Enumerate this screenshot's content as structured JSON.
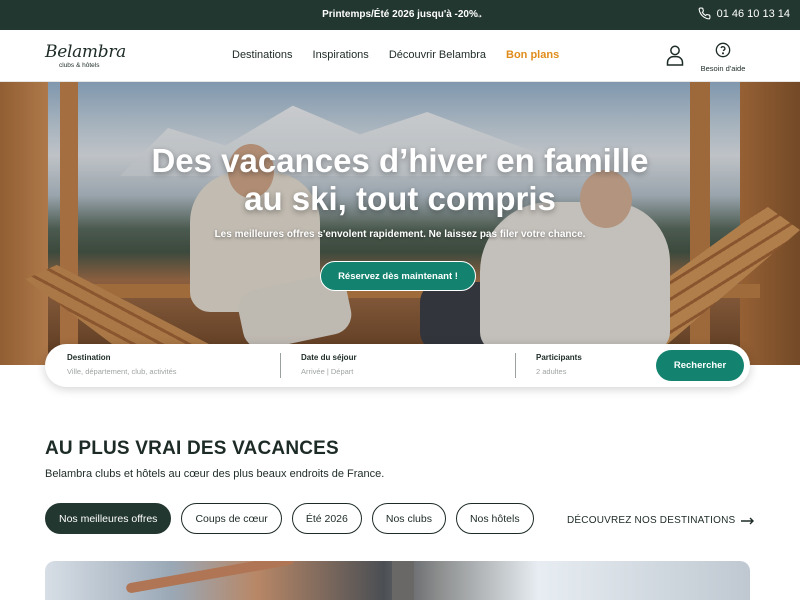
{
  "promo": {
    "text": "Printemps/Été 2026 jusqu'à -20%",
    "arrow_icon": "arrow-right-icon",
    "phone": "01 46 10 13 14",
    "phone_icon": "phone-icon"
  },
  "header": {
    "logo_main": "Belambra",
    "logo_sub": "clubs & hôtels",
    "nav": [
      "Destinations",
      "Inspirations",
      "Découvrir Belambra",
      "Bon plans"
    ],
    "account_icon": "user-icon",
    "help_label": "Besoin d'aide",
    "help_icon": "question-circle-icon"
  },
  "hero": {
    "title_line1": "Des vacances d’hiver en famille",
    "title_line2": "au ski, tout compris",
    "subtitle": "Les meilleures offres s'envolent rapidement. Ne laissez pas filer votre chance.",
    "cta": "Réservez dès maintenant !"
  },
  "search": {
    "destination_label": "Destination",
    "destination_placeholder": "Ville, département, club, activités",
    "dates_label": "Date du séjour",
    "dates_placeholder": "Arrivée | Départ",
    "participants_label": "Participants",
    "participants_value": "2 adultes",
    "button": "Rechercher"
  },
  "section": {
    "title": "AU PLUS VRAI DES VACANCES",
    "description": "Belambra clubs et hôtels au cœur des plus beaux endroits de France.",
    "filters": [
      "Nos meilleures offres",
      "Coups de cœur",
      "Été 2026",
      "Nos clubs",
      "Nos hôtels"
    ],
    "active_filter": "Nos meilleures offres",
    "discover_link": "DÉCOUVREZ NOS DESTINATIONS"
  },
  "colors": {
    "dark_green": "#22372f",
    "teal": "#13836f",
    "accent_orange": "#e08c1b"
  }
}
